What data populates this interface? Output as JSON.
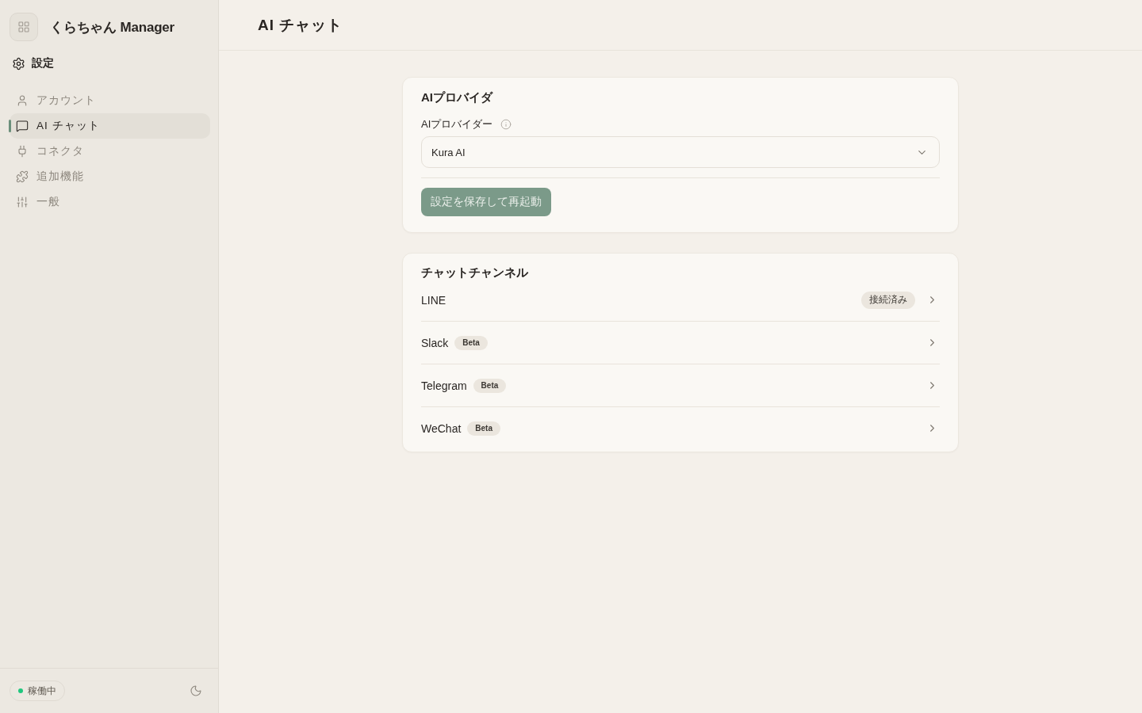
{
  "app": {
    "title": "くらちゃん Manager"
  },
  "sidebar": {
    "section": "設定",
    "items": [
      {
        "label": "アカウント",
        "kind": "account",
        "selected": false
      },
      {
        "label": "AI チャット",
        "kind": "chat",
        "selected": true
      },
      {
        "label": "コネクタ",
        "kind": "connector",
        "selected": false
      },
      {
        "label": "追加機能",
        "kind": "extension",
        "selected": false
      },
      {
        "label": "一般",
        "kind": "general",
        "selected": false
      }
    ],
    "status": {
      "label": "稼働中",
      "color": "#1fc77e"
    }
  },
  "header": {
    "title": "AI チャット"
  },
  "provider_card": {
    "title": "AIプロバイダ",
    "field_label": "AIプロバイダー",
    "select_value": "Kura AI",
    "save_button": {
      "label": "設定を保存して再起動",
      "disabled": true
    }
  },
  "channels_card": {
    "title": "チャットチャンネル",
    "channels": [
      {
        "name": "LINE",
        "badge": "接続済み",
        "kind": "connected"
      },
      {
        "name": "Slack",
        "badge": "Beta",
        "kind": "beta"
      },
      {
        "name": "Telegram",
        "badge": "Beta",
        "kind": "beta"
      },
      {
        "name": "WeChat",
        "badge": "Beta",
        "kind": "beta"
      }
    ]
  }
}
